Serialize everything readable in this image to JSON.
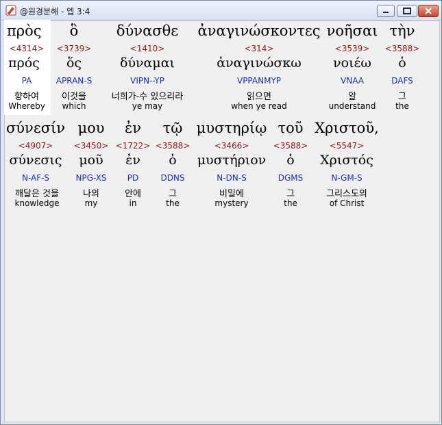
{
  "window": {
    "title": "@원경분해 - 엡 3:4"
  },
  "lines": [
    {
      "words": [
        {
          "greek": "πρὸς",
          "strong": "<4314>",
          "lemma": "πρός",
          "morph": "PA",
          "korean": "향하여",
          "english": "Whereby"
        },
        {
          "greek": "ὃ",
          "strong": "<3739>",
          "lemma": "ὅς",
          "morph": "APRAN-S",
          "korean": "이것을",
          "english": "which"
        },
        {
          "greek": "δύνασθε",
          "strong": "<1410>",
          "lemma": "δύναμαι",
          "morph": "VIPN--YP",
          "korean": "너희가-수 있으리라",
          "english": "ye may"
        },
        {
          "greek": "ἀναγινώσκοντες",
          "strong": "<314>",
          "lemma": "ἀναγινώσκω",
          "morph": "VPPANMYP",
          "korean": "읽으면",
          "english": "when ye read"
        },
        {
          "greek": "νοῆσαι",
          "strong": "<3539>",
          "lemma": "νοιέω",
          "morph": "VNAA",
          "korean": "알",
          "english": "understand"
        },
        {
          "greek": "τὴν",
          "strong": "<3588>",
          "lemma": "ὁ",
          "morph": "DAFS",
          "korean": "그",
          "english": "the"
        }
      ]
    },
    {
      "words": [
        {
          "greek": "σύνεσίν",
          "strong": "<4907>",
          "lemma": "σύνεσις",
          "morph": "N-AF-S",
          "korean": "깨달은 것을",
          "english": "knowledge"
        },
        {
          "greek": "μου",
          "strong": "<3450>",
          "lemma": "μοῦ",
          "morph": "NPG-XS",
          "korean": "나의",
          "english": "my"
        },
        {
          "greek": "ἐν",
          "strong": "<1722>",
          "lemma": "ἐν",
          "morph": "PD",
          "korean": "안에",
          "english": "in"
        },
        {
          "greek": "τῷ",
          "strong": "<3588>",
          "lemma": "ὁ",
          "morph": "DDNS",
          "korean": "그",
          "english": "the"
        },
        {
          "greek": "μυστηρίῳ",
          "strong": "<3466>",
          "lemma": "μυστήριον",
          "morph": "N-DN-S",
          "korean": "비밀에",
          "english": "mystery"
        },
        {
          "greek": "τοῦ",
          "strong": "<3588>",
          "lemma": "ὁ",
          "morph": "DGMS",
          "korean": "그",
          "english": "the"
        },
        {
          "greek": "Χριστοῦ,",
          "strong": "<5547>",
          "lemma": "Χριστός",
          "morph": "N-GM-S",
          "korean": "그리스도의",
          "english": "of Christ"
        }
      ]
    }
  ]
}
